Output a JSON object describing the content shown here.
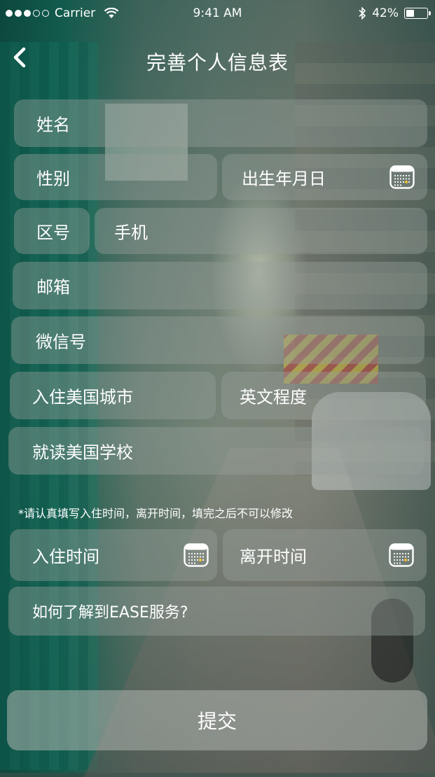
{
  "status_bar": {
    "carrier": "Carrier",
    "time": "9:41 AM",
    "battery_percent": "42%",
    "battery_level": 0.42
  },
  "nav": {
    "title": "完善个人信息表",
    "back_icon": "chevron-left-icon"
  },
  "form": {
    "name_placeholder": "姓名",
    "gender_placeholder": "性别",
    "birthdate_placeholder": "出生年月日",
    "area_code_placeholder": "区号",
    "phone_placeholder": "手机",
    "email_placeholder": "邮箱",
    "wechat_placeholder": "微信号",
    "city_placeholder": "入住美国城市",
    "english_level_placeholder": "英文程度",
    "school_placeholder": "就读美国学校",
    "notice": "*请认真填写入住时间，离开时间，填完之后不可以修改",
    "checkin_placeholder": "入住时间",
    "checkout_placeholder": "离开时间",
    "source_placeholder": "如何了解到EASE服务?",
    "submit_label": "提交"
  },
  "icons": {
    "calendar": "calendar-icon",
    "wifi": "wifi-icon",
    "bluetooth": "bluetooth-icon",
    "battery": "battery-icon"
  },
  "colors": {
    "text": "#ffffff",
    "field_bg": "rgba(150,160,155,0.42)"
  }
}
